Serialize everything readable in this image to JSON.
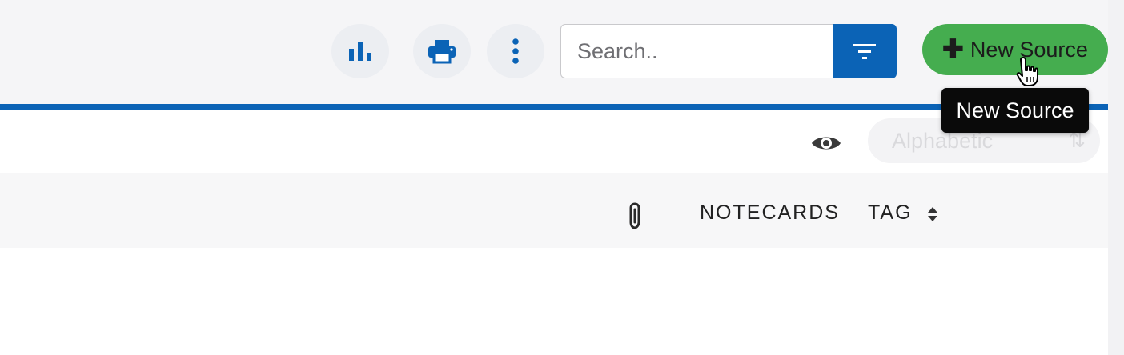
{
  "toolbar": {
    "stats_icon": "bar-chart-icon",
    "print_icon": "printer-icon",
    "more_icon": "more-vertical-icon",
    "filter_icon": "filter-icon",
    "search": {
      "placeholder": "Search..",
      "value": ""
    },
    "new_source_label": "New Source",
    "tooltip_text": "New Source"
  },
  "view_controls": {
    "visibility_icon": "eye-icon",
    "sort_value": "Alphabetic",
    "sort_icon": "sort-arrows-icon"
  },
  "table": {
    "attachment_icon": "paperclip-icon",
    "columns": [
      "NOTECARDS",
      "TAG"
    ],
    "tag_sort_icon": "sort-caret-icon"
  },
  "colors": {
    "accent": "#0b63b6",
    "new_button": "#45ad4f",
    "tooltip_bg": "#0a0a0a"
  }
}
